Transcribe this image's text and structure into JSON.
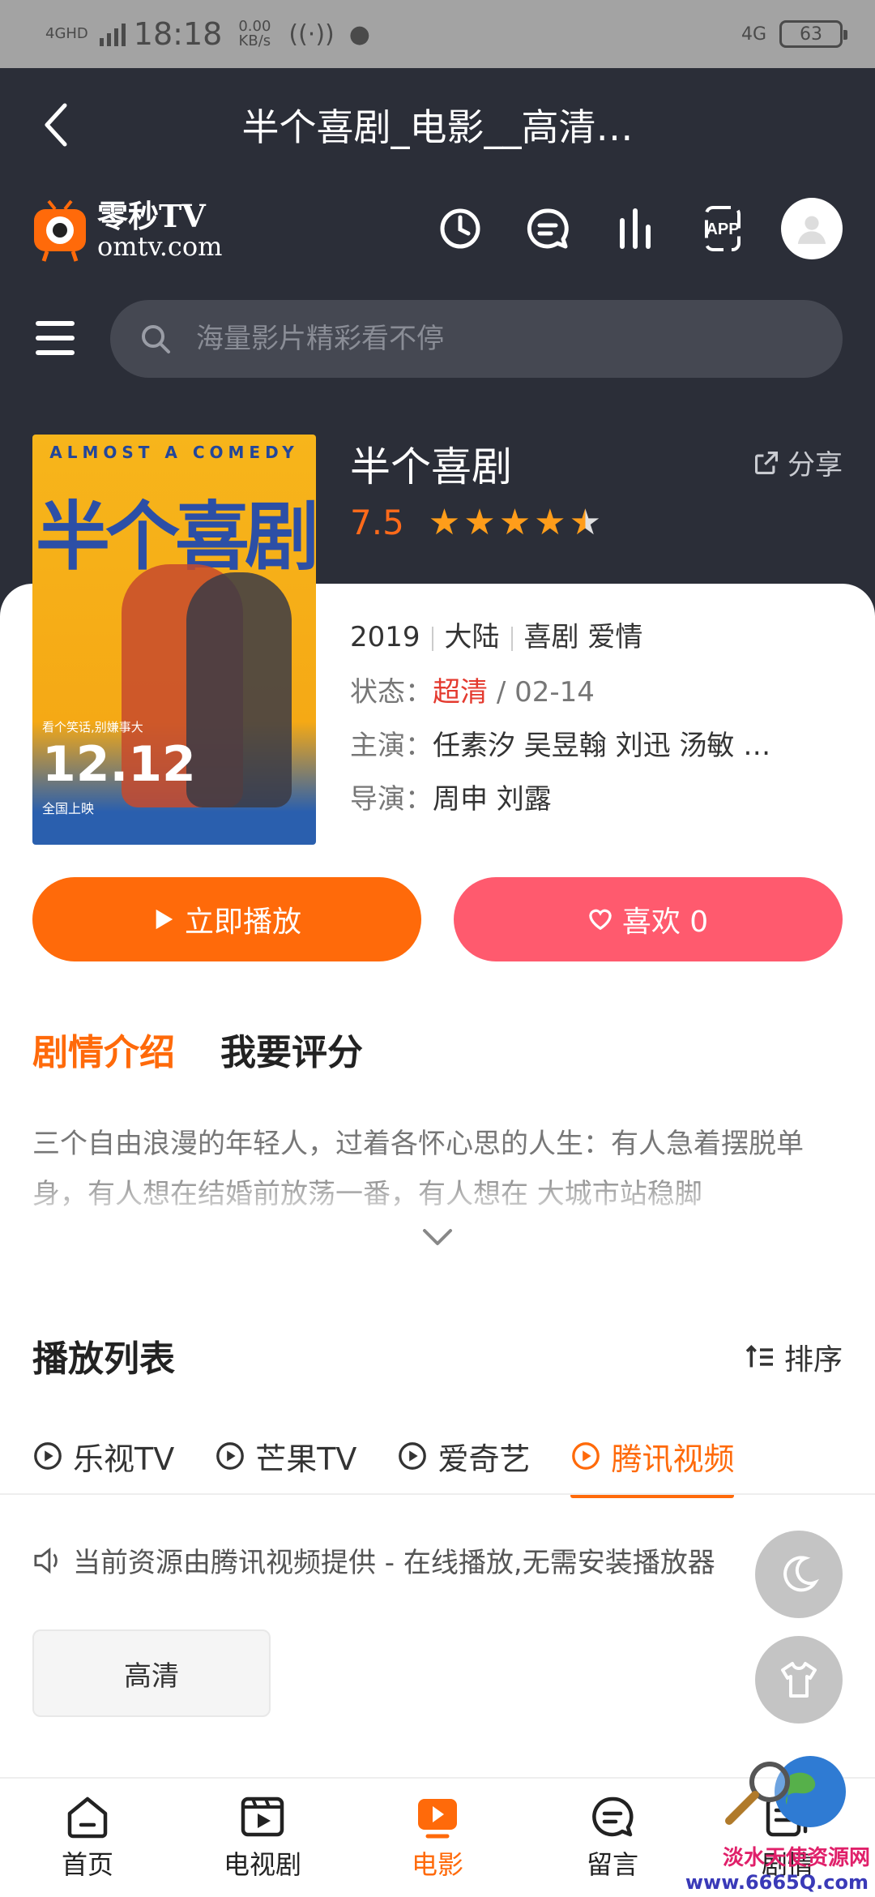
{
  "status_bar": {
    "network": "4GHD",
    "time": "18:18",
    "speed_value": "0.00",
    "speed_unit": "KB/s",
    "network_right": "4G",
    "battery": "63"
  },
  "title_bar": {
    "title": "半个喜剧_电影__高清…"
  },
  "logo": {
    "name": "零秒TV",
    "domain": "omtv.com"
  },
  "header_icons": [
    "history-icon",
    "message-icon",
    "chart-icon",
    "app-icon",
    "avatar"
  ],
  "header_app_label": "APP",
  "search": {
    "placeholder": "海量影片精彩看不停"
  },
  "movie": {
    "title": "半个喜剧",
    "share_label": "分享",
    "score": "7.5",
    "stars": 4.5,
    "year": "2019",
    "region": "大陆",
    "genres": "喜剧 爱情",
    "status_label": "状态：",
    "status_value": "超清",
    "status_date": "/ 02-14",
    "cast_label": "主演：",
    "cast_value": "任素汐 吴昱翰 刘迅 汤敏 …",
    "director_label": "导演：",
    "director_value": "周申 刘露"
  },
  "poster": {
    "top_text": "ALMOST A COMEDY",
    "title": "半个喜剧",
    "tagline": "看个笑话,别嫌事大",
    "date": "12.12",
    "release": "全国上映"
  },
  "actions": {
    "play": "立即播放",
    "like": "喜欢 0"
  },
  "tabs": {
    "intro": "剧情介绍",
    "rate": "我要评分"
  },
  "description": "三个自由浪漫的年轻人，过着各怀心思的人生：有人急着摆脱单身，有人想在结婚前放荡一番，有人想在 大城市站稳脚",
  "playlist": {
    "title": "播放列表",
    "sort": "排序",
    "sources": [
      "乐视TV",
      "芒果TV",
      "爱奇艺",
      "腾讯视频"
    ],
    "active_source": 3,
    "notice": "当前资源由腾讯视频提供 - 在线播放,无需安装播放器",
    "episodes": [
      "高清"
    ]
  },
  "bottom_nav": [
    {
      "label": "首页",
      "icon": "home-icon"
    },
    {
      "label": "电视剧",
      "icon": "tv-series-icon"
    },
    {
      "label": "电影",
      "icon": "movie-icon"
    },
    {
      "label": "留言",
      "icon": "message-icon"
    },
    {
      "label": "剧情",
      "icon": "plot-icon"
    }
  ],
  "active_nav": 2,
  "watermark": {
    "text": "淡水天使资源网",
    "url": "www.6665Q.com"
  },
  "colors": {
    "accent": "#ff6a0a",
    "like": "#ff5a6e",
    "header_bg": "#2b2e38",
    "hd": "#e43a2f"
  }
}
